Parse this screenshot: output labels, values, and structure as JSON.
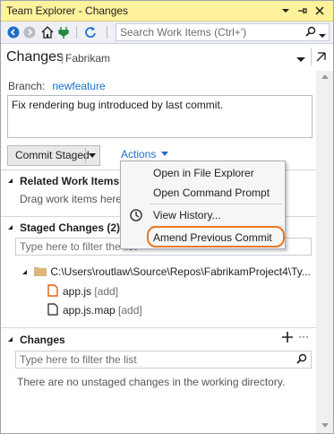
{
  "titlebar": {
    "title": "Team Explorer - Changes"
  },
  "toolbar": {
    "search_placeholder": "Search Work Items (Ctrl+')"
  },
  "header": {
    "title": "Changes",
    "project": "Fabrikam"
  },
  "branch": {
    "label": "Branch:",
    "name": "newfeature"
  },
  "commit_message": "Fix rendering bug introduced by last commit.",
  "commit_button": "Commit Staged",
  "actions_label": "Actions",
  "sections": {
    "related": {
      "title": "Related Work Items",
      "hint": "Drag work items here"
    },
    "staged": {
      "title": "Staged Changes (2)",
      "filter_placeholder": "Type here to filter the list",
      "folder": "C:\\Users\\routlaw\\Source\\Repos\\FabrikamProject4\\Ty...",
      "files": [
        {
          "name": "app.js",
          "status": "[add]"
        },
        {
          "name": "app.js.map",
          "status": "[add]"
        }
      ]
    },
    "changes": {
      "title": "Changes",
      "filter_placeholder": "Type here to filter the list",
      "empty_text": "There are no unstaged changes in the working directory."
    }
  },
  "actions_menu": [
    "Open in File Explorer",
    "Open Command Prompt",
    "View History...",
    "Amend Previous Commit"
  ],
  "colors": {
    "title_bar": "#fff29d",
    "link": "#1e6fc8",
    "highlight": "#e87722"
  }
}
